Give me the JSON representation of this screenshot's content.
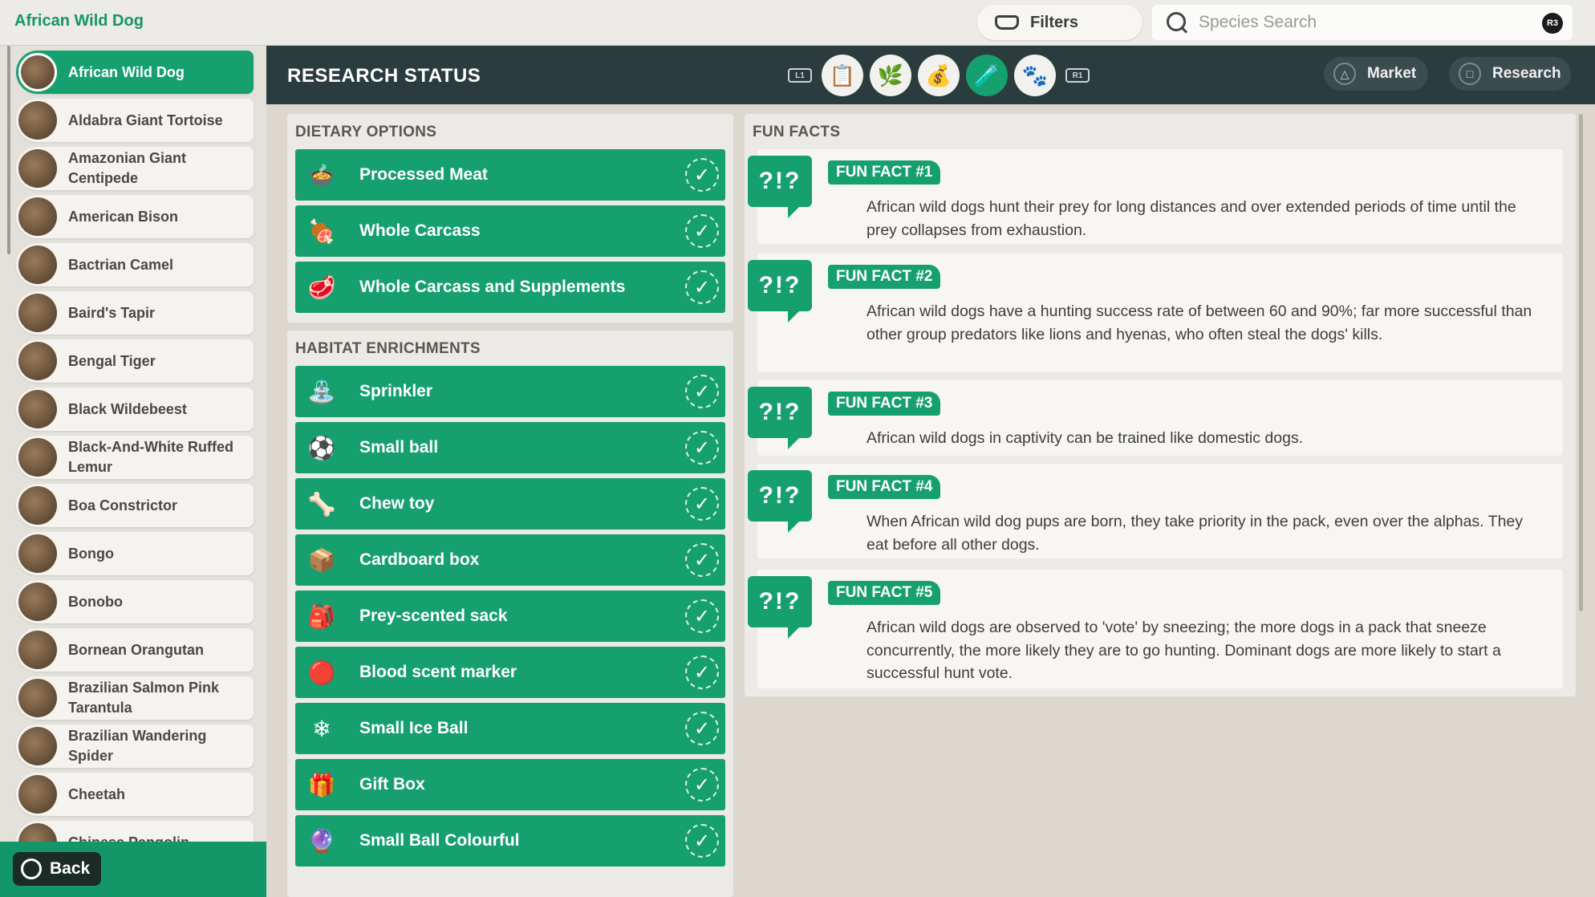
{
  "topbar": {
    "title": "African Wild Dog",
    "filters_label": "Filters",
    "search_placeholder": "Species Search",
    "search_badge": "R3"
  },
  "sidebar": {
    "items": [
      {
        "name": "African Wild Dog",
        "active": true
      },
      {
        "name": "Aldabra Giant Tortoise"
      },
      {
        "name": "Amazonian Giant Centipede"
      },
      {
        "name": "American Bison"
      },
      {
        "name": "Bactrian Camel"
      },
      {
        "name": "Baird's Tapir"
      },
      {
        "name": "Bengal Tiger"
      },
      {
        "name": "Black Wildebeest"
      },
      {
        "name": "Black-And-White Ruffed Lemur"
      },
      {
        "name": "Boa Constrictor"
      },
      {
        "name": "Bongo"
      },
      {
        "name": "Bonobo"
      },
      {
        "name": "Bornean Orangutan"
      },
      {
        "name": "Brazilian Salmon Pink Tarantula"
      },
      {
        "name": "Brazilian Wandering Spider"
      },
      {
        "name": "Cheetah"
      },
      {
        "name": "Chinese Pangolin"
      }
    ],
    "back_label": "Back"
  },
  "header": {
    "title": "RESEARCH STATUS",
    "left_shoulder": "L1",
    "right_shoulder": "R1",
    "tabs": [
      {
        "icon": "clipboard-icon"
      },
      {
        "icon": "habitat-icon"
      },
      {
        "icon": "food-sack-icon"
      },
      {
        "icon": "enrichment-icon",
        "active": true
      },
      {
        "icon": "paw-icon"
      }
    ],
    "market_label": "Market",
    "market_glyph": "△",
    "research_label": "Research",
    "research_glyph": "□"
  },
  "dietary": {
    "title": "DIETARY OPTIONS",
    "items": [
      {
        "label": "Processed Meat",
        "icon": "meat-bowl-icon",
        "glyph": "🍲"
      },
      {
        "label": "Whole Carcass",
        "icon": "carcass-icon",
        "glyph": "🍖"
      },
      {
        "label": "Whole Carcass and Supplements",
        "icon": "carcass-supplements-icon",
        "glyph": "🥩"
      }
    ]
  },
  "habitat": {
    "title": "HABITAT ENRICHMENTS",
    "items": [
      {
        "label": "Sprinkler",
        "icon": "sprinkler-icon",
        "glyph": "⛲"
      },
      {
        "label": "Small ball",
        "icon": "small-ball-icon",
        "glyph": "⚽"
      },
      {
        "label": "Chew toy",
        "icon": "chew-toy-icon",
        "glyph": "🦴"
      },
      {
        "label": "Cardboard box",
        "icon": "cardboard-box-icon",
        "glyph": "📦"
      },
      {
        "label": "Prey-scented sack",
        "icon": "scented-sack-icon",
        "glyph": "🎒"
      },
      {
        "label": "Blood scent marker",
        "icon": "blood-marker-icon",
        "glyph": "🔴"
      },
      {
        "label": "Small Ice Ball",
        "icon": "ice-ball-icon",
        "glyph": "❄"
      },
      {
        "label": "Gift Box",
        "icon": "gift-box-icon",
        "glyph": "🎁"
      },
      {
        "label": "Small Ball Colourful",
        "icon": "colourful-ball-icon",
        "glyph": "🔮"
      }
    ]
  },
  "check_glyph": "✓",
  "facts": {
    "title": "FUN FACTS",
    "bubble_text": "?!?",
    "items": [
      {
        "tag": "FUN FACT #1",
        "text": "African wild dogs hunt their prey for long distances and over extended periods of time until the prey collapses from exhaustion."
      },
      {
        "tag": "FUN FACT #2",
        "text": "African wild dogs have a hunting success rate of between 60 and 90%; far more successful than other group predators like lions and hyenas, who often steal the dogs' kills."
      },
      {
        "tag": "FUN FACT #3",
        "text": "African wild dogs in captivity can be trained like domestic dogs."
      },
      {
        "tag": "FUN FACT #4",
        "text": "When African wild dog pups are born, they take priority in the pack, even over the alphas. They eat before all other dogs."
      },
      {
        "tag": "FUN FACT #5",
        "text": "African wild dogs are observed to 'vote' by sneezing; the more dogs in a pack that sneeze concurrently, the more likely they are to go hunting. Dominant dogs are more likely to start a successful hunt vote."
      }
    ]
  },
  "colors": {
    "accent": "#17a06f",
    "header_bg": "#2a3c3e",
    "panel_bg": "#eceae6"
  }
}
